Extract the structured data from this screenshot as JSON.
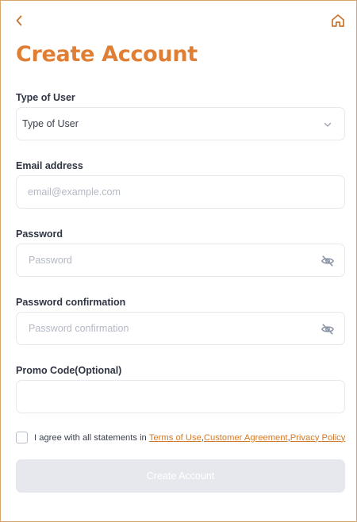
{
  "header": {
    "back_icon": "chevron-left-icon",
    "home_icon": "home-icon",
    "title": "Create Account"
  },
  "form": {
    "user_type": {
      "label": "Type of User",
      "value": "Type of User",
      "icon": "chevron-down-icon"
    },
    "email": {
      "label": "Email address",
      "placeholder": "email@example.com",
      "value": ""
    },
    "password": {
      "label": "Password",
      "placeholder": "Password",
      "value": "",
      "icon": "eye-off-icon"
    },
    "password_confirmation": {
      "label": "Password confirmation",
      "placeholder": "Password confirmation",
      "value": "",
      "icon": "eye-off-icon"
    },
    "promo": {
      "label": "Promo Code(Optional)",
      "placeholder": "",
      "value": ""
    }
  },
  "agreement": {
    "checked": false,
    "text": "I agree with all statements in ",
    "terms_link": "Terms of Use",
    "sep1": ", ",
    "customer_link": "Customer Agreement",
    "sep2": ", ",
    "privacy_link": "Privacy Policy"
  },
  "submit": {
    "label": "Create Account",
    "disabled": true
  },
  "colors": {
    "accent": "#e07f33",
    "border": "#d9a46d",
    "input_border": "#e6e8ee",
    "disabled_button": "#e6e8ee"
  }
}
